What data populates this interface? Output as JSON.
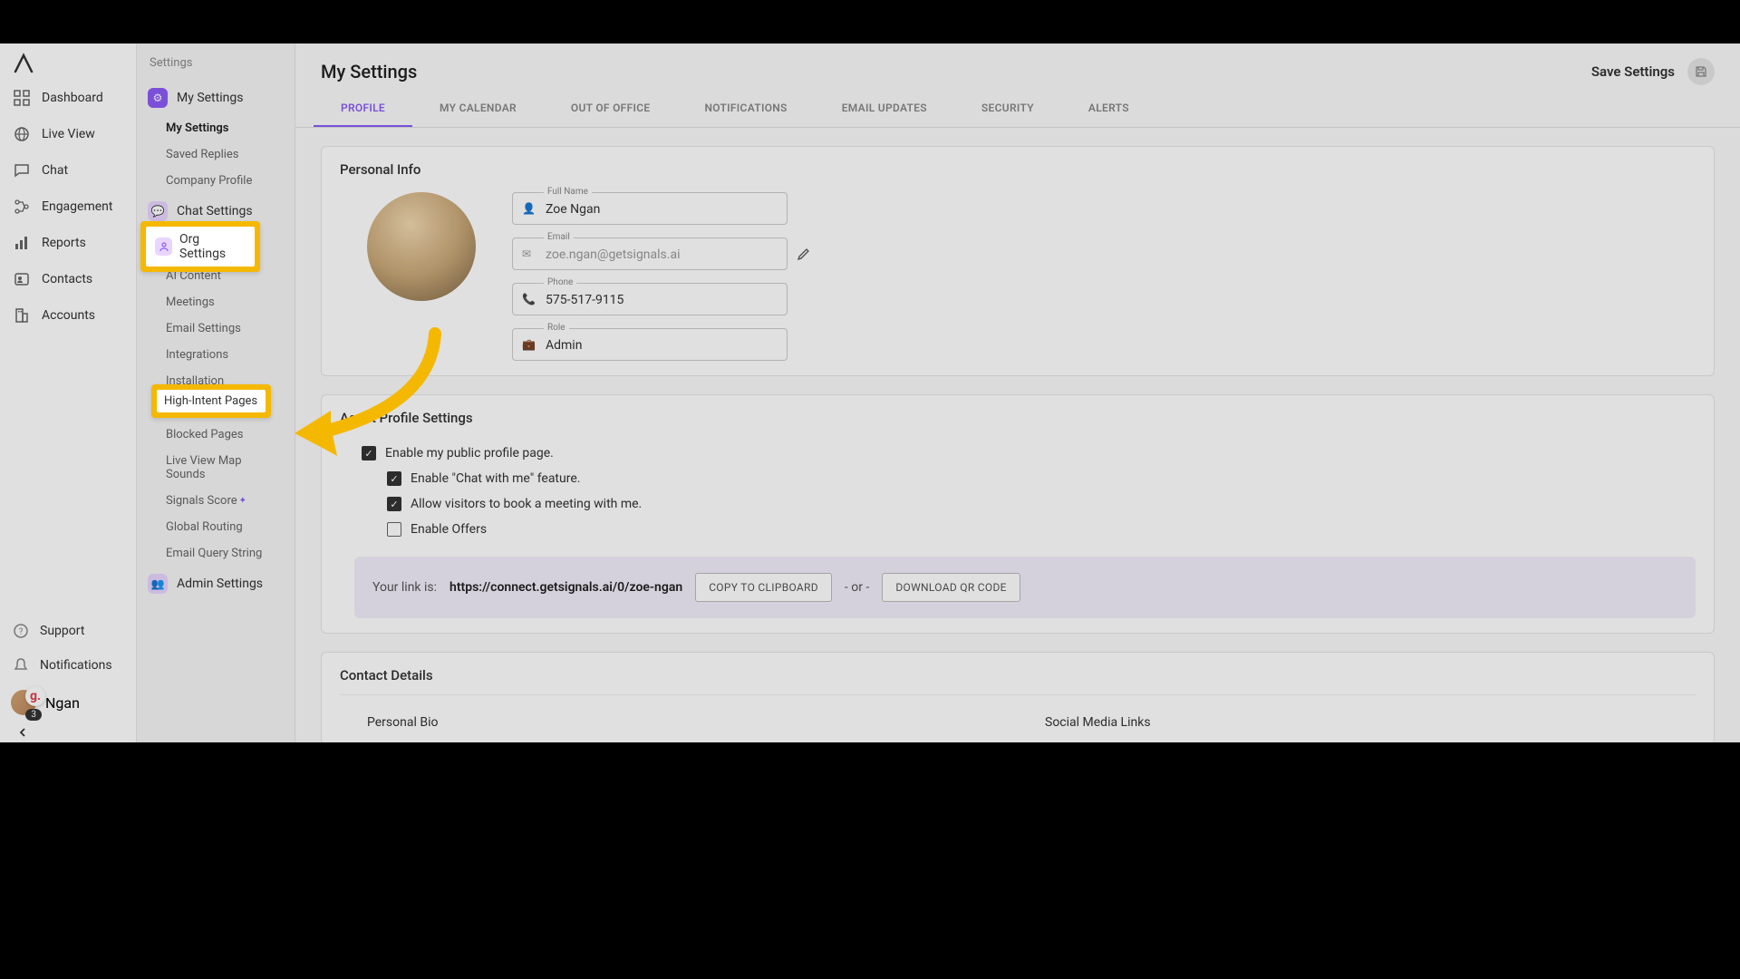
{
  "leftnav": {
    "items": [
      {
        "label": "Dashboard"
      },
      {
        "label": "Live View"
      },
      {
        "label": "Chat"
      },
      {
        "label": "Engagement"
      },
      {
        "label": "Reports"
      },
      {
        "label": "Contacts"
      },
      {
        "label": "Accounts"
      }
    ],
    "support": "Support",
    "notifications": "Notifications",
    "user_name": "Ngan",
    "notif_count": "3"
  },
  "settingsnav": {
    "crumb": "Settings",
    "my_settings": "My Settings",
    "my_settings_sub": "My Settings",
    "saved_replies": "Saved Replies",
    "company_profile": "Company Profile",
    "chat_settings": "Chat Settings",
    "org_settings": "Org Settings",
    "ai_content": "AI Content",
    "meetings": "Meetings",
    "email_settings": "Email Settings",
    "integrations": "Integrations",
    "installation": "Installation",
    "high_intent": "High-Intent Pages",
    "blocked_pages": "Blocked Pages",
    "live_view_sounds": "Live View Map Sounds",
    "signals_score": "Signals Score",
    "global_routing": "Global Routing",
    "email_query": "Email Query String",
    "admin_settings": "Admin Settings"
  },
  "main": {
    "title": "My Settings",
    "save": "Save Settings",
    "tabs": [
      "PROFILE",
      "MY CALENDAR",
      "OUT OF OFFICE",
      "NOTIFICATIONS",
      "EMAIL UPDATES",
      "SECURITY",
      "ALERTS"
    ]
  },
  "personal": {
    "heading": "Personal Info",
    "full_name_label": "Full Name",
    "full_name": "Zoe Ngan",
    "email_label": "Email",
    "email": "zoe.ngan@getsignals.ai",
    "phone_label": "Phone",
    "phone": "575-517-9115",
    "role_label": "Role",
    "role": "Admin"
  },
  "agent": {
    "heading": "Agent Profile Settings",
    "enable_public": "Enable my public profile page.",
    "enable_chat": "Enable \"Chat with me\" feature.",
    "allow_book": "Allow visitors to book a meeting with me.",
    "enable_offers": "Enable Offers",
    "link_prefix": "Your link is: ",
    "link_url": "https://connect.getsignals.ai/0/zoe-ngan",
    "copy_btn": "COPY TO CLIPBOARD",
    "or": "- or -",
    "qr_btn": "DOWNLOAD QR CODE"
  },
  "contact": {
    "heading": "Contact Details",
    "bio": "Personal Bio",
    "social": "Social Media Links"
  }
}
